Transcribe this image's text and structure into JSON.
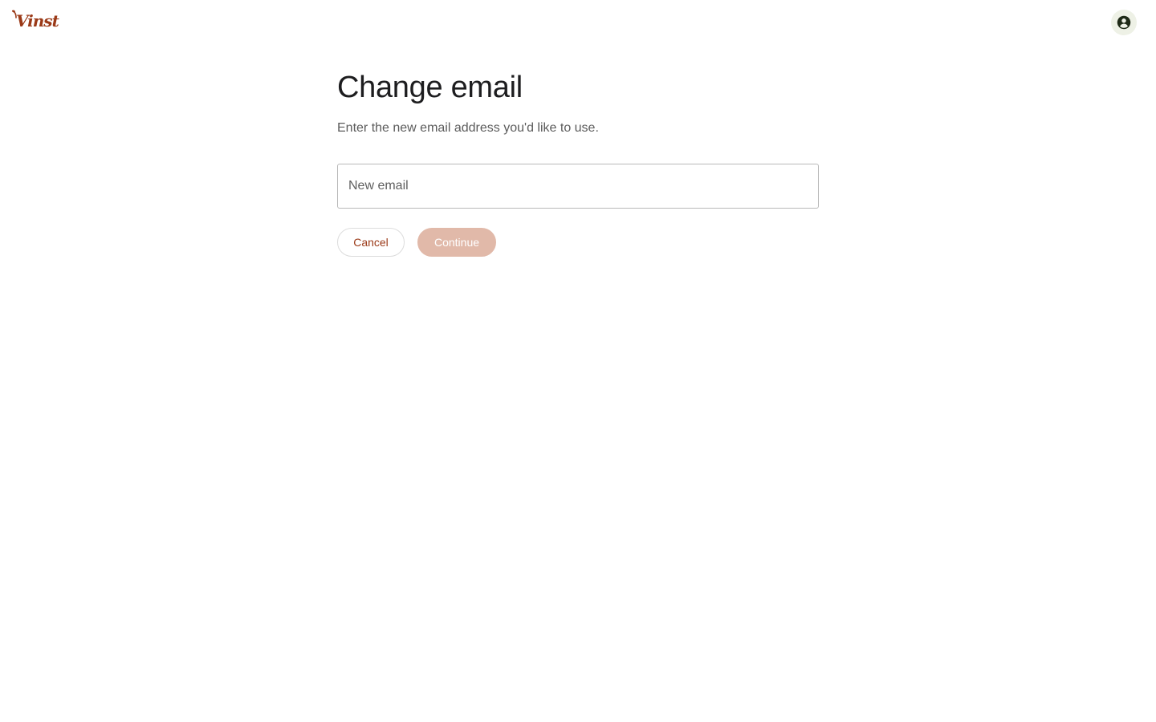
{
  "header": {
    "logo_text": "Vinst",
    "logo_icon": "vinst-logo",
    "account_icon": "account-circle-icon"
  },
  "main": {
    "title": "Change email",
    "subtitle": "Enter the new email address you'd like to use.",
    "email_input": {
      "placeholder": "New email",
      "value": ""
    },
    "cancel_label": "Cancel",
    "continue_label": "Continue",
    "continue_disabled": true
  },
  "colors": {
    "brand": "#9b3a18",
    "continue_disabled_bg": "#e1b9a9",
    "account_button_bg": "#eef1e6"
  }
}
